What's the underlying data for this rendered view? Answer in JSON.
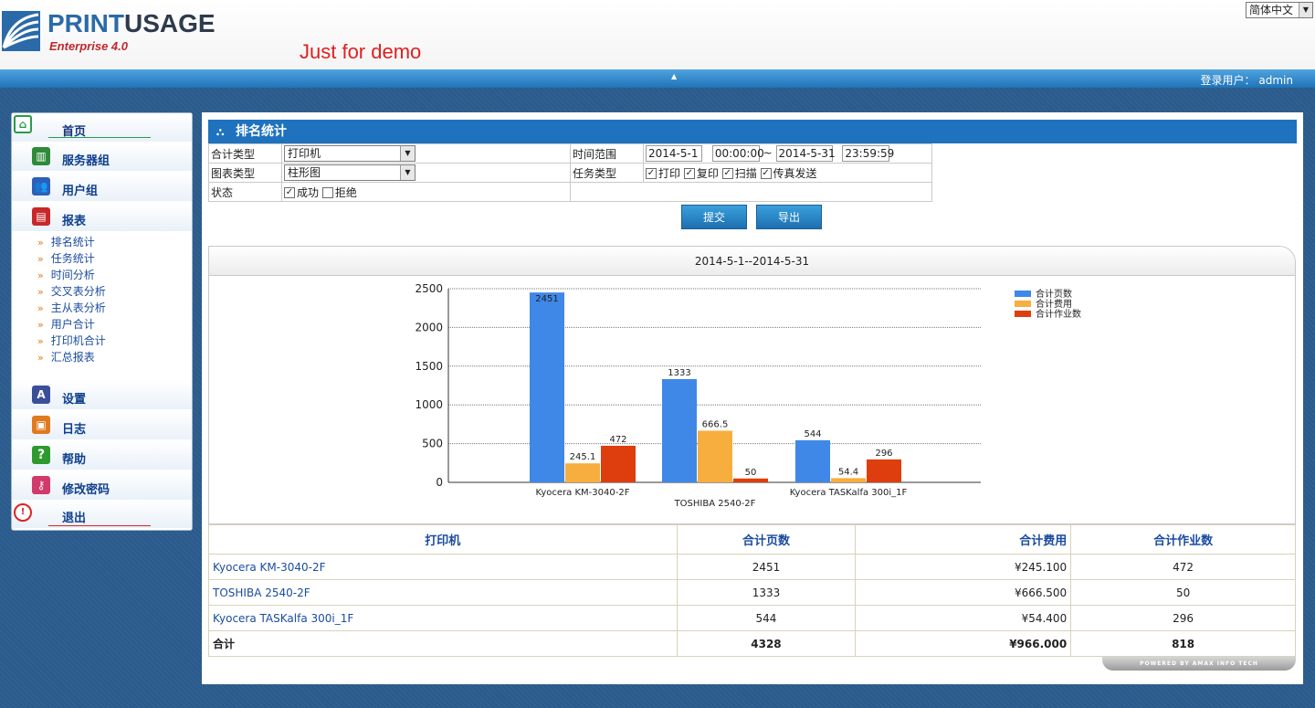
{
  "header": {
    "logo_name_a": "PRINT",
    "logo_name_b": "USAGE",
    "logo_sub": "Enterprise 4.0",
    "demo_text": "Just for demo",
    "language": "简体中文",
    "user_label": "登录用户：",
    "user_name": "admin"
  },
  "sidebar": {
    "home": "首页",
    "server_group": "服务器组",
    "user_group": "用户组",
    "reports": "报表",
    "report_items": [
      "排名统计",
      "任务统计",
      "时间分析",
      "交叉表分析",
      "主从表分析",
      "用户合计",
      "打印机合计",
      "汇总报表"
    ],
    "settings": "设置",
    "logs": "日志",
    "help": "帮助",
    "change_password": "修改密码",
    "logout": "退出"
  },
  "panel": {
    "title": "排名统计"
  },
  "filter": {
    "sum_type_label": "合计类型",
    "sum_type_value": "打印机",
    "chart_type_label": "图表类型",
    "chart_type_value": "柱形图",
    "status_label": "状态",
    "status_success": "成功",
    "status_reject": "拒绝",
    "time_range_label": "时间范围",
    "start_date": "2014-5-1",
    "start_time": "00:00:00",
    "tilde": "~",
    "end_date": "2014-5-31",
    "end_time": "23:59:59",
    "task_type_label": "任务类型",
    "task_print": "打印",
    "task_copy": "复印",
    "task_scan": "扫描",
    "task_fax": "传真发送",
    "submit": "提交",
    "export": "导出"
  },
  "chart_data": {
    "type": "bar",
    "title": "2014-5-1--2014-5-31",
    "categories": [
      "Kyocera KM-3040-2F",
      "TOSHIBA 2540-2F",
      "Kyocera TASKalfa 300i_1F"
    ],
    "series": [
      {
        "name": "合计页数",
        "values": [
          2451,
          1333,
          544
        ],
        "labels": [
          "2451",
          "1333",
          "544"
        ],
        "color": "#3f88e8"
      },
      {
        "name": "合计费用",
        "values": [
          245.1,
          666.5,
          54.4
        ],
        "labels": [
          "245.1",
          "666.5",
          "54.4"
        ],
        "color": "#f7ae3e"
      },
      {
        "name": "合计作业数",
        "values": [
          472,
          50,
          296
        ],
        "labels": [
          "472",
          "50",
          "296"
        ],
        "color": "#de3e0e"
      }
    ],
    "ylim": [
      0,
      2500
    ],
    "yticks": [
      "0",
      "500",
      "1000",
      "1500",
      "2000",
      "2500"
    ],
    "grid": true,
    "legend": "top-right"
  },
  "table": {
    "headers": [
      "打印机",
      "合计页数",
      "合计费用",
      "合计作业数"
    ],
    "rows": [
      [
        "Kyocera KM-3040-2F",
        "2451",
        "¥245.100",
        "472"
      ],
      [
        "TOSHIBA 2540-2F",
        "1333",
        "¥666.500",
        "50"
      ],
      [
        "Kyocera TASKalfa 300i_1F",
        "544",
        "¥54.400",
        "296"
      ]
    ],
    "total": [
      "合计",
      "4328",
      "¥966.000",
      "818"
    ]
  },
  "footer": {
    "powered": "POWERED BY AMAX INFO TECH"
  }
}
